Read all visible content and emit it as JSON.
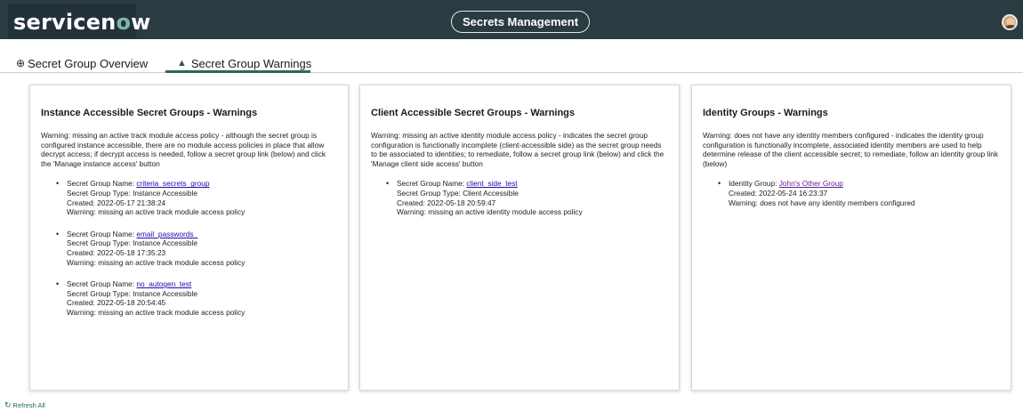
{
  "header": {
    "logo": "servicenow",
    "title": "Secrets Management",
    "icons": {
      "avatar": "user-avatar"
    },
    "colors": {
      "bar": "#2b3b42",
      "logo_bg": "#23313a",
      "logo_accent": "#81b5a1"
    }
  },
  "tabs": [
    {
      "label": "Secret Group Overview",
      "icon": "overview-icon"
    },
    {
      "label": "Secret Group Warnings",
      "icon": "warning-triangle-icon",
      "active": true
    }
  ],
  "cards": [
    {
      "title": "Instance Accessible Secret Groups - Warnings",
      "description": "Warning: missing an active track module access policy - although the secret group is configured instance accessible, there are no module access policies in place that allow decrypt access; if decrypt access is needed, follow a secret group link (below) and click the 'Manage instance access' button",
      "entries": [
        {
          "name_label": "Secret Group Name: ",
          "name": "criteria_secrets_group",
          "type": "Secret Group Type: Instance Accessible",
          "created": "Created: 2022-05-17 21:38:24",
          "warning": "Warning: missing an active track module access policy"
        },
        {
          "name_label": "Secret Group Name: ",
          "name": "email_passwords_",
          "type": "Secret Group Type: Instance Accessible",
          "created": "Created: 2022-05-18 17:35:23",
          "warning": "Warning: missing an active track module access policy"
        },
        {
          "name_label": "Secret Group Name: ",
          "name": "no_autogen_test",
          "type": "Secret Group Type: Instance Accessible",
          "created": "Created: 2022-05-18 20:54:45",
          "warning": "Warning: missing an active track module access policy"
        }
      ]
    },
    {
      "title": "Client Accessible Secret Groups - Warnings",
      "description": "Warning: missing an active identity module access policy - indicates the secret group configuration is functionally incomplete (client-accessible side) as the secret group needs to be associated to identities; to remediate, follow a secret group link (below) and click the 'Manage client side access' button",
      "entries": [
        {
          "name_label": "Secret Group Name: ",
          "name": "client_side_test",
          "type": "Secret Group Type: Client Accessible",
          "created": "Created: 2022-05-18 20:59:47",
          "warning": "Warning: missing an active identity module access policy"
        }
      ]
    },
    {
      "title": "Identity Groups - Warnings",
      "description": "Warning: does not have any identity members configured - indicates the identity group configuration is functionally incomplete, associated identity members are used to help determine release of the client accessible secret; to remediate, follow an identity group link (below)",
      "entries": [
        {
          "name_label": "Identity Group: ",
          "name": "John's Other Group",
          "created": "Created: 2022-05-24 16:23:37",
          "warning": "Warning: does not have any identity members configured"
        }
      ]
    }
  ],
  "footer": {
    "refresh_label": "Refresh All",
    "refresh_icon": "refresh-icon"
  }
}
